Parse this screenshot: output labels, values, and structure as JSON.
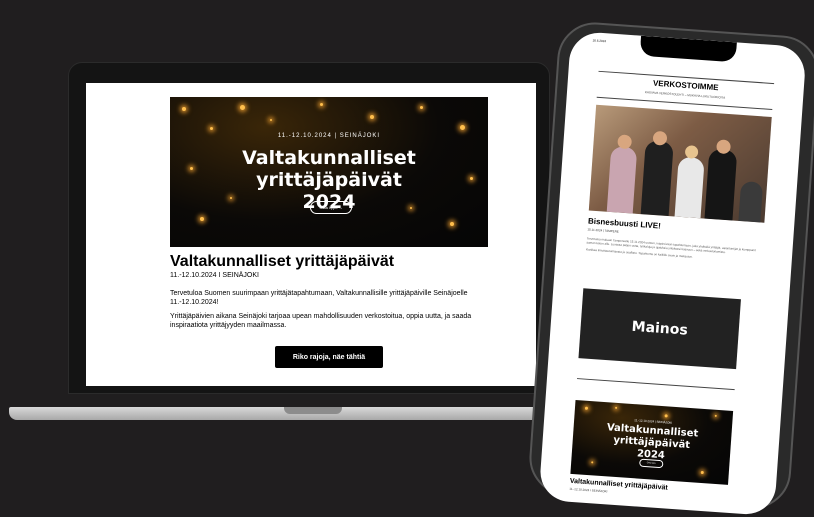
{
  "laptop": {
    "hero": {
      "date_line": "11.-12.10.2024 | SEINÄJOKI",
      "title_line1": "Valtakunnalliset yrittäjäpäivät",
      "title_line2": "2024",
      "button": "Osta lippu →"
    },
    "title": "Valtakunnalliset yrittäjäpäivät",
    "subtitle": "11.-12.10.2024 I SEINÄJOKI",
    "paragraph1": "Tervetuloa Suomen suurimpaan yrittäjätapahtumaan, Valtakunnallisille yrittäjäpäiville Seinäjoelle 11.-12.10.2024!",
    "paragraph2": "Yrittäjäpäivien aikana Seinäjoki tarjoaa upean mahdollisuuden verkostoitua, oppia uutta, ja saada inspiraatiota yrittäjyyden maailmassa.",
    "cta": "Riko rajoja, näe tähtiä"
  },
  "phone": {
    "status_time": "20.6.2024",
    "newsletter_title": "VERKOSTOIMME",
    "newsletter_tagline": "KASVAVA VERKOSTOLEHTI – MUKAVIA LUKUTUOKIOITA",
    "article": {
      "title": "Bisnesbuusti LIVE!",
      "date": "15.11.2024 | TAMPERE",
      "text1": "Tervetuloa mukaan Tampereelle 15.11.2024 uuteen, inspiroivaan tapahtumaan, joka yhdistää yrittäjät, asiantuntijat ja kumppanit saman katon alle. Luvassa paljon uutta, työkaluja ja ajatuksia yrityksesi kasvuun – sekä verkostoitumista.",
      "text2": "Kurkkaa ilmoittautumisesta ja osallistu. Tapahtuma on kaikille avoin ja maksuton."
    },
    "ad_label": "Mainos",
    "hero": {
      "date_line": "11.-12.10.2024 | SEINÄJOKI",
      "title_line1": "Valtakunnalliset yrittäjäpäivät",
      "title_line2": "2024",
      "button": "Osta lippu"
    },
    "event_title": "Valtakunnalliset yrittäjäpäivät",
    "event_date": "11.-12.10.2024 I SEINÄJOKI"
  }
}
